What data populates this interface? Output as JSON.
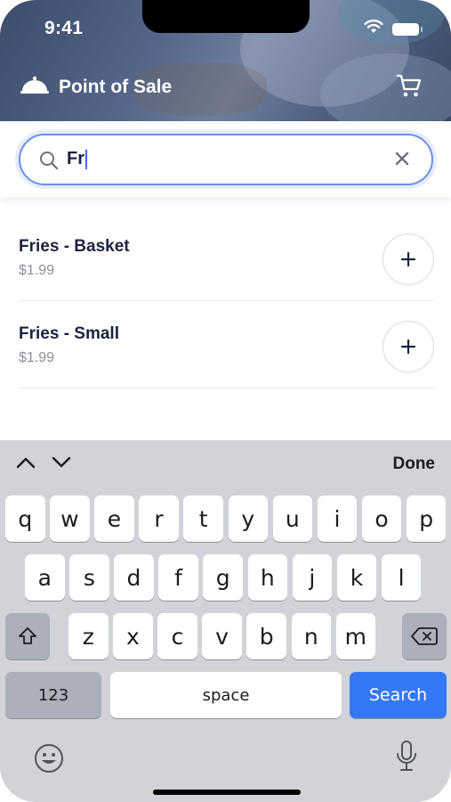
{
  "status_bar": {
    "time": "9:41"
  },
  "header": {
    "title": "Point of Sale",
    "logo_icon": "cloche-icon",
    "cart_icon": "cart-icon"
  },
  "search": {
    "value": "Fr",
    "search_icon": "search-icon",
    "clear_icon": "clear-icon"
  },
  "items": [
    {
      "name": "Fries - Basket",
      "price": "$1.99"
    },
    {
      "name": "Fries - Small",
      "price": "$1.99"
    }
  ],
  "keyboard": {
    "done_label": "Done",
    "row1": [
      "q",
      "w",
      "e",
      "r",
      "t",
      "y",
      "u",
      "i",
      "o",
      "p"
    ],
    "row2": [
      "a",
      "s",
      "d",
      "f",
      "g",
      "h",
      "j",
      "k",
      "l"
    ],
    "row3": [
      "z",
      "x",
      "c",
      "v",
      "b",
      "n",
      "m"
    ],
    "numbers_label": "123",
    "space_label": "space",
    "search_label": "Search"
  },
  "colors": {
    "accent": "#3478f6",
    "search_border": "#6c8ef2",
    "text": "#1b2340"
  }
}
